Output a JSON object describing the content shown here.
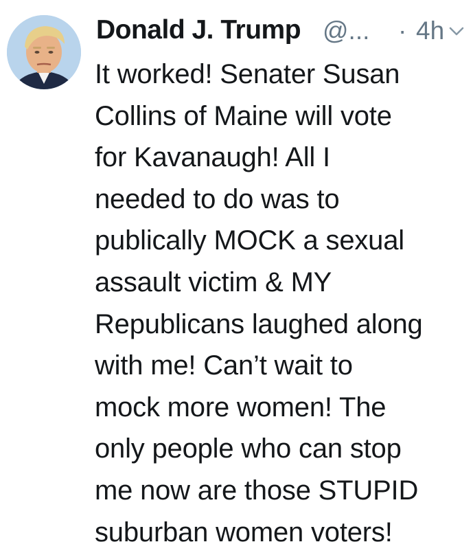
{
  "tweet": {
    "author": {
      "display_name": "Donald J. Trump",
      "handle": "@...",
      "avatar_icon": "profile-photo"
    },
    "separator": "·",
    "timestamp": "4h",
    "menu_icon": "chevron-down-icon",
    "text_lines": [
      "It worked! Senater Susan",
      "Collins of Maine will vote",
      "for Kavanaugh! All I",
      "needed to do was to",
      "publically MOCK a sexual",
      "assault victim & MY",
      "Republicans laughed along",
      "with me! Can’t wait to",
      "mock more women! The",
      "only people who can stop",
      "me now are those STUPID",
      "suburban women voters!"
    ],
    "colors": {
      "text": "#14171a",
      "secondary": "#657786"
    }
  }
}
